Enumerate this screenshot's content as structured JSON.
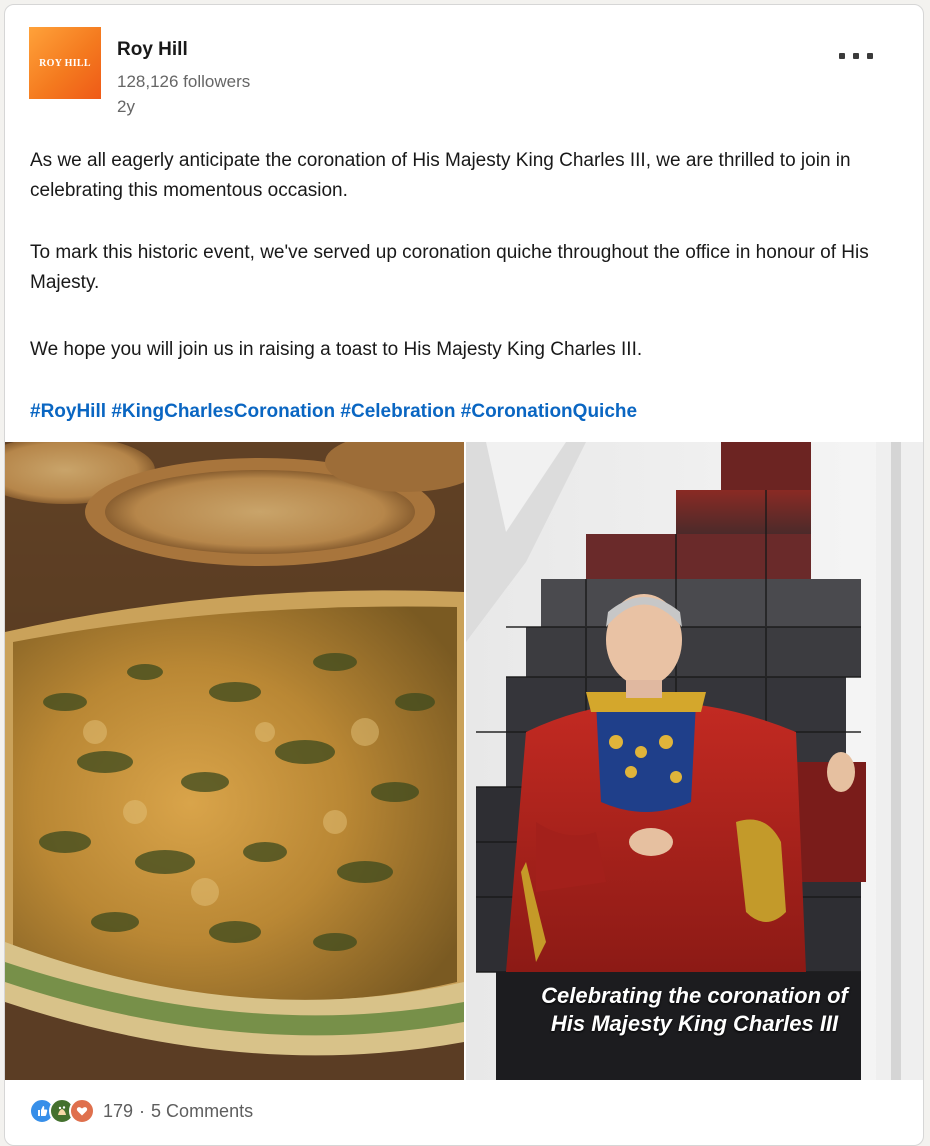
{
  "post": {
    "company_name": "Roy Hill",
    "logo_text": "ROY HILL",
    "followers": "128,126 followers",
    "time_ago": "2y",
    "more_menu_icon": "more-horizontal-icon",
    "paragraphs": [
      "As we all eagerly anticipate the coronation of His Majesty King Charles III, we are thrilled to join in celebrating this momentous occasion.",
      "To mark this historic event, we've served up coronation quiche throughout the office in honour of His Majesty.",
      "We hope you will join us in raising a toast to His Majesty King Charles III."
    ],
    "hashtags": [
      "#RoyHill",
      "#KingCharlesCoronation",
      "#Celebration",
      "#CoronationQuiche"
    ],
    "images": {
      "left": "quiche-photo",
      "right": "king-portrait-mosaic-photo",
      "right_caption_line1": "Celebrating the coronation of",
      "right_caption_line2": "His Majesty King Charles III"
    },
    "social": {
      "reaction_icons": [
        "like-icon",
        "celebrate-icon",
        "love-icon"
      ],
      "reaction_count": "179",
      "separator": "·",
      "comments": "5 Comments"
    },
    "colors": {
      "link": "#0a66c2",
      "logo_orange": "#f47a1f"
    }
  }
}
